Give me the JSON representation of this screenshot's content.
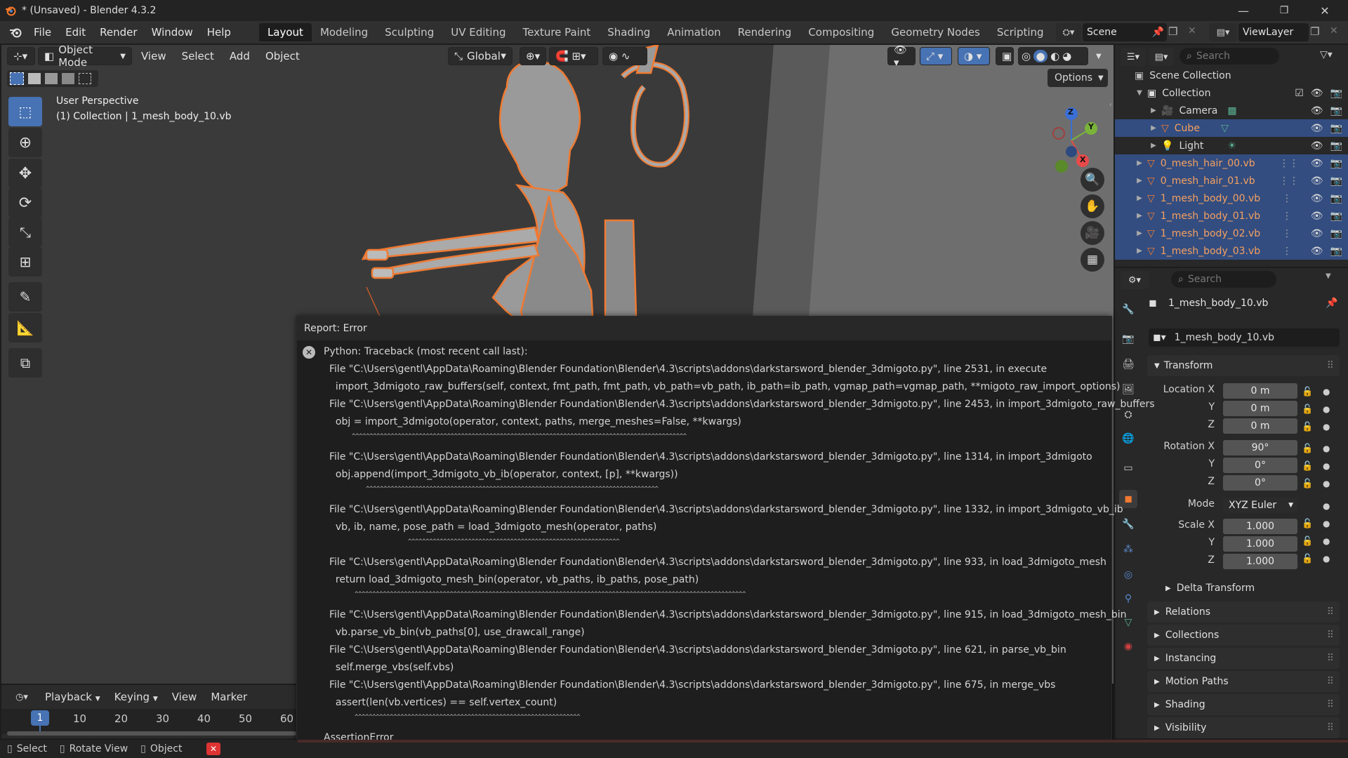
{
  "titlebar": {
    "title": "* (Unsaved) - Blender 4.3.2",
    "minimize": "—",
    "maximize": "❐",
    "close": "✕"
  },
  "menubar": {
    "menus": [
      "File",
      "Edit",
      "Render",
      "Window",
      "Help"
    ],
    "workspaces": [
      "Layout",
      "Modeling",
      "Sculpting",
      "UV Editing",
      "Texture Paint",
      "Shading",
      "Animation",
      "Rendering",
      "Compositing",
      "Geometry Nodes",
      "Scripting"
    ],
    "active_workspace": "Layout",
    "add_tab": "+",
    "scene": "Scene",
    "view_layer": "ViewLayer"
  },
  "viewport_header": {
    "mode": "Object Mode",
    "menus": [
      "View",
      "Select",
      "Add",
      "Object"
    ],
    "orientation": "Global",
    "options": "Options"
  },
  "viewport_overlay": {
    "perspective": "User Perspective",
    "collection_info": "(1) Collection | 1_mesh_body_10.vb"
  },
  "gizmo": {
    "z": "Z",
    "y": "Y",
    "x": "X"
  },
  "outliner": {
    "search_placeholder": "Search",
    "scene_collection": "Scene Collection",
    "collection": "Collection",
    "items": [
      {
        "name": "Camera",
        "selected": false
      },
      {
        "name": "Cube",
        "selected": true
      },
      {
        "name": "Light",
        "selected": false
      },
      {
        "name": "0_mesh_hair_00.vb",
        "selected": true
      },
      {
        "name": "0_mesh_hair_01.vb",
        "selected": true
      },
      {
        "name": "1_mesh_body_00.vb",
        "selected": true
      },
      {
        "name": "1_mesh_body_01.vb",
        "selected": true
      },
      {
        "name": "1_mesh_body_02.vb",
        "selected": true
      },
      {
        "name": "1_mesh_body_03.vb",
        "selected": true
      }
    ]
  },
  "properties": {
    "search_placeholder": "Search",
    "object_name": "1_mesh_body_10.vb",
    "object_field": "1_mesh_body_10.vb",
    "transform_label": "Transform",
    "location_label": "Location X",
    "rotation_label": "Rotation X",
    "scale_label": "Scale X",
    "mode_label": "Mode",
    "axis_y": "Y",
    "axis_z": "Z",
    "location": [
      "0 m",
      "0 m",
      "0 m"
    ],
    "rotation": [
      "90°",
      "0°",
      "0°"
    ],
    "rotation_mode": "XYZ Euler",
    "scale": [
      "1.000",
      "1.000",
      "1.000"
    ],
    "delta_transform": "Delta Transform",
    "panels": [
      "Relations",
      "Collections",
      "Instancing",
      "Motion Paths",
      "Shading",
      "Visibility"
    ]
  },
  "timeline": {
    "menus": [
      "Playback",
      "Keying",
      "View",
      "Marker"
    ],
    "current_frame": "1",
    "frames": [
      "10",
      "20",
      "30",
      "40",
      "50",
      "60"
    ]
  },
  "error_report": {
    "title": "Report: Error",
    "header": "Python: Traceback (most recent call last):",
    "lines": [
      "File \"C:\\Users\\gentl\\AppData\\Roaming\\Blender Foundation\\Blender\\4.3\\scripts\\addons\\darkstarsword_blender_3dmigoto.py\", line 2531, in execute",
      "  import_3dmigoto_raw_buffers(self, context, fmt_path, fmt_path, vb_path=vb_path, ib_path=ib_path, vgmap_path=vgmap_path, **migoto_raw_import_options)",
      "File \"C:\\Users\\gentl\\AppData\\Roaming\\Blender Foundation\\Blender\\4.3\\scripts\\addons\\darkstarsword_blender_3dmigoto.py\", line 2453, in import_3dmigoto_raw_buffers",
      "  obj = import_3dmigoto(operator, context, paths, merge_meshes=False, **kwargs)",
      "File \"C:\\Users\\gentl\\AppData\\Roaming\\Blender Foundation\\Blender\\4.3\\scripts\\addons\\darkstarsword_blender_3dmigoto.py\", line 1314, in import_3dmigoto",
      "  obj.append(import_3dmigoto_vb_ib(operator, context, [p], **kwargs))",
      "File \"C:\\Users\\gentl\\AppData\\Roaming\\Blender Foundation\\Blender\\4.3\\scripts\\addons\\darkstarsword_blender_3dmigoto.py\", line 1332, in import_3dmigoto_vb_ib",
      "  vb, ib, name, pose_path = load_3dmigoto_mesh(operator, paths)",
      "File \"C:\\Users\\gentl\\AppData\\Roaming\\Blender Foundation\\Blender\\4.3\\scripts\\addons\\darkstarsword_blender_3dmigoto.py\", line 933, in load_3dmigoto_mesh",
      "  return load_3dmigoto_mesh_bin(operator, vb_paths, ib_paths, pose_path)",
      "File \"C:\\Users\\gentl\\AppData\\Roaming\\Blender Foundation\\Blender\\4.3\\scripts\\addons\\darkstarsword_blender_3dmigoto.py\", line 915, in load_3dmigoto_mesh_bin",
      "  vb.parse_vb_bin(vb_paths[0], use_drawcall_range)",
      "File \"C:\\Users\\gentl\\AppData\\Roaming\\Blender Foundation\\Blender\\4.3\\scripts\\addons\\darkstarsword_blender_3dmigoto.py\", line 621, in parse_vb_bin",
      "  self.merge_vbs(self.vbs)",
      "File \"C:\\Users\\gentl\\AppData\\Roaming\\Blender Foundation\\Blender\\4.3\\scripts\\addons\\darkstarsword_blender_3dmigoto.py\", line 675, in merge_vbs",
      "  assert(len(vb.vertices) == self.vertex_count)"
    ],
    "footer": "AssertionError"
  },
  "statusbar": {
    "select": "Select",
    "rotate": "Rotate View",
    "object": "Object"
  },
  "colors": {
    "accent": "#4772b3",
    "selection_orange": "#f07a32",
    "error_red": "#e84a4a",
    "selected_row": "#334d80"
  }
}
